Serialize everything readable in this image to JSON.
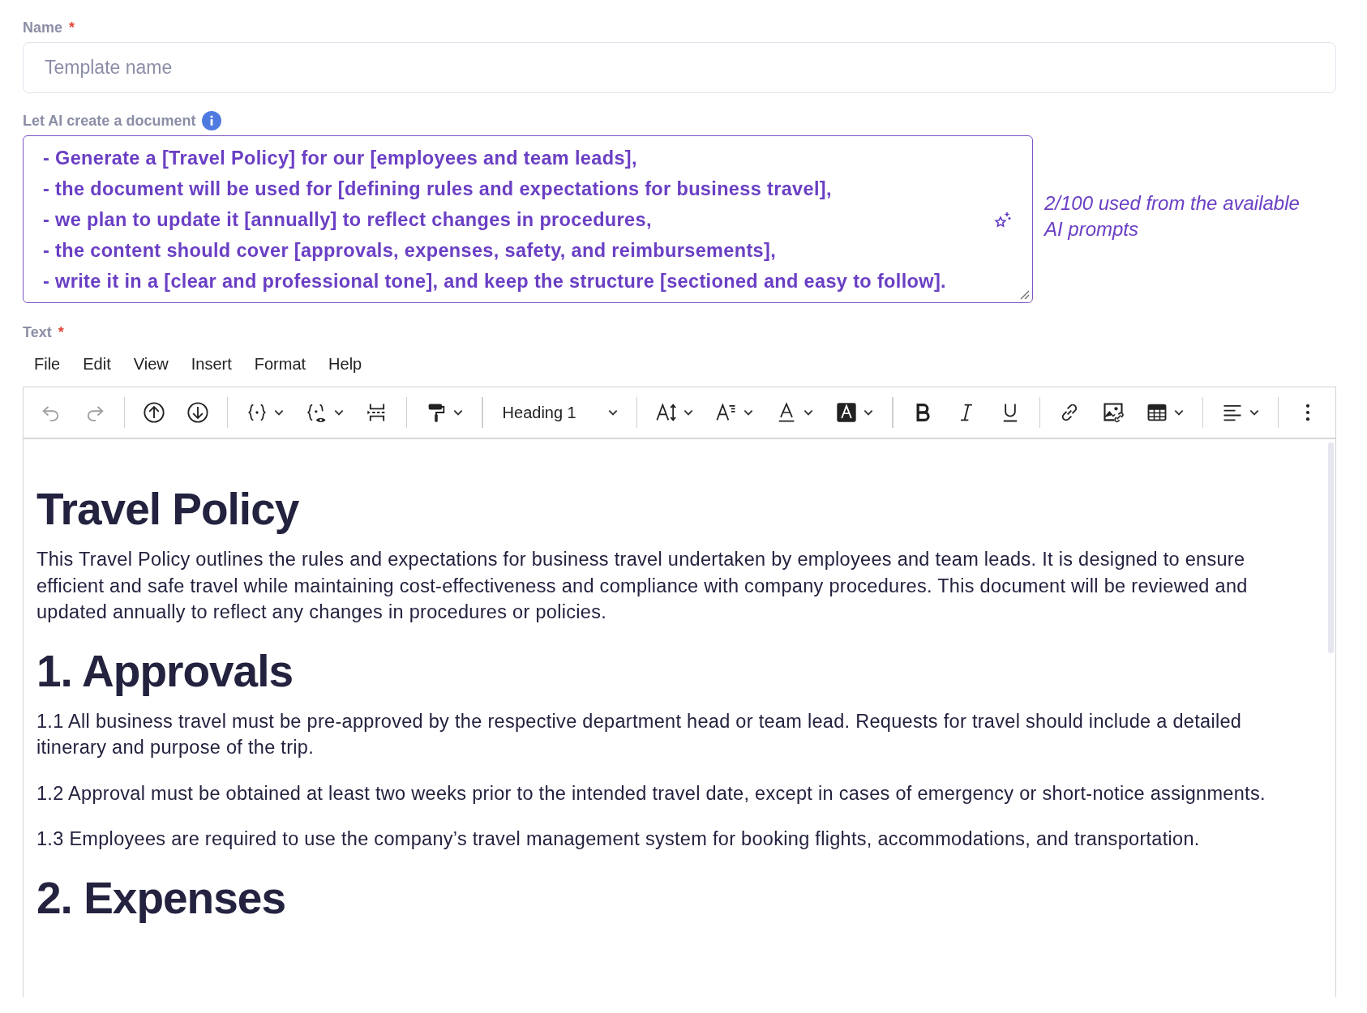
{
  "name_field": {
    "label": "Name",
    "required_mark": "*",
    "placeholder": "Template name"
  },
  "ai_prompt": {
    "label": "Let AI create a document",
    "lines": [
      "- Generate a [Travel Policy] for our [employees and team leads],",
      "- the document will be used for [defining rules and expectations for business travel],",
      "- we plan to update it [annually] to reflect changes in procedures,",
      "- the content should cover [approvals, expenses, safety, and reimbursements],",
      "- write it in a [clear and professional tone], and keep the structure [sectioned and easy to follow]."
    ],
    "usage_note": "2/100 used from the available AI prompts"
  },
  "text_field": {
    "label": "Text",
    "required_mark": "*"
  },
  "menu": [
    "File",
    "Edit",
    "View",
    "Insert",
    "Format",
    "Help"
  ],
  "toolbar": [
    [
      {
        "kind": "undo",
        "disabled": true
      },
      {
        "kind": "redo",
        "disabled": true
      }
    ],
    [
      {
        "kind": "upload"
      },
      {
        "kind": "download"
      }
    ],
    [
      {
        "kind": "variable",
        "dropdown": true
      },
      {
        "kind": "preview-variable",
        "dropdown": true
      },
      {
        "kind": "page-break"
      }
    ],
    [
      {
        "kind": "format-painter",
        "dropdown": true
      }
    ],
    [
      {
        "kind": "block-select",
        "value": "Heading 1"
      }
    ],
    [
      {
        "kind": "font-size",
        "dropdown": true
      },
      {
        "kind": "line-height",
        "dropdown": true
      },
      {
        "kind": "text-color",
        "dropdown": true
      },
      {
        "kind": "highlight",
        "dropdown": true
      }
    ],
    [
      {
        "kind": "bold"
      },
      {
        "kind": "italic"
      },
      {
        "kind": "underline"
      }
    ],
    [
      {
        "kind": "link"
      },
      {
        "kind": "image"
      },
      {
        "kind": "table",
        "dropdown": true
      }
    ],
    [
      {
        "kind": "align",
        "dropdown": true
      }
    ],
    [
      {
        "kind": "more"
      }
    ]
  ],
  "document": [
    {
      "kind": "heading",
      "text": "Travel Policy"
    },
    {
      "kind": "paragraph",
      "text": "This Travel Policy outlines the rules and expectations for business travel undertaken by employees and team leads. It is designed to ensure efficient and safe travel while maintaining cost-effectiveness and compliance with company procedures. This document will be reviewed and updated annually to reflect any changes in procedures or policies."
    },
    {
      "kind": "heading",
      "text": "1. Approvals"
    },
    {
      "kind": "paragraph",
      "text": "1.1 All business travel must be pre-approved by the respective department head or team lead. Requests for travel should include a detailed itinerary and purpose of the trip."
    },
    {
      "kind": "paragraph",
      "text": "1.2 Approval must be obtained at least two weeks prior to the intended travel date, except in cases of emergency or short-notice assignments."
    },
    {
      "kind": "paragraph",
      "text": "1.3 Employees are required to use the company’s travel management system for booking flights, accommodations, and transportation."
    },
    {
      "kind": "heading",
      "text": "2. Expenses"
    }
  ]
}
